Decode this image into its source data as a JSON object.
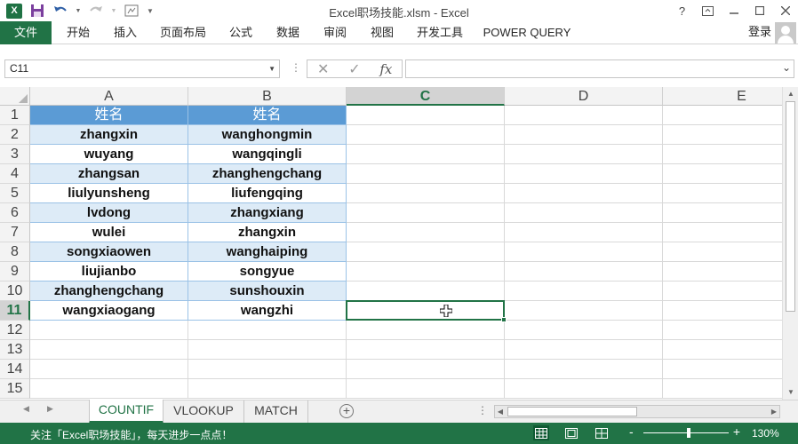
{
  "window": {
    "title": "Excel职场技能.xlsm - Excel",
    "controls": [
      "?",
      "restore-ribbon",
      "minimize",
      "maximize",
      "close"
    ]
  },
  "quick_access": {
    "app_icon": "excel-logo",
    "items": [
      "save-icon",
      "undo-icon",
      "redo-icon",
      "macro-icon",
      "customize-icon"
    ]
  },
  "ribbon": {
    "tabs": [
      {
        "label": "文件"
      },
      {
        "label": "开始"
      },
      {
        "label": "插入"
      },
      {
        "label": "页面布局"
      },
      {
        "label": "公式"
      },
      {
        "label": "数据"
      },
      {
        "label": "审阅"
      },
      {
        "label": "视图"
      },
      {
        "label": "开发工具"
      },
      {
        "label": "POWER QUERY"
      }
    ],
    "login": "登录"
  },
  "formula_bar": {
    "name_box": "C11",
    "cancel_icon": "✕",
    "enter_icon": "✓",
    "fx": "fx",
    "formula": ""
  },
  "sheet": {
    "columns": [
      "A",
      "B",
      "C",
      "D",
      "E"
    ],
    "selected_column": "C",
    "rows": [
      "1",
      "2",
      "3",
      "4",
      "5",
      "6",
      "7",
      "8",
      "9",
      "10",
      "11",
      "12",
      "13",
      "14",
      "15"
    ],
    "selected_row": "11",
    "active_cell": "C11",
    "header_row": [
      "姓名",
      "姓名"
    ],
    "data": [
      [
        "zhangxin",
        "wanghongmin"
      ],
      [
        "wuyang",
        "wangqingli"
      ],
      [
        "zhangsan",
        "zhanghengchang"
      ],
      [
        "liulyunsheng",
        "liufengqing"
      ],
      [
        "lvdong",
        "zhangxiang"
      ],
      [
        "wulei",
        "zhangxin"
      ],
      [
        "songxiaowen",
        "wanghaiping"
      ],
      [
        "liujianbo",
        "songyue"
      ],
      [
        "zhanghengchang",
        "sunshouxin"
      ],
      [
        "wangxiaogang",
        "wangzhi"
      ]
    ]
  },
  "sheet_tabs": {
    "tabs": [
      "COUNTIF",
      "VLOOKUP",
      "MATCH"
    ],
    "active": "COUNTIF",
    "add_label": "+"
  },
  "status_bar": {
    "message": "关注「Excel职场技能」，每天进步一点点！",
    "zoom": "130%",
    "zoom_minus": "-",
    "zoom_plus": "+"
  },
  "colors": {
    "accent": "#217346",
    "table_header": "#5b9bd5",
    "table_band": "#ddebf7"
  }
}
